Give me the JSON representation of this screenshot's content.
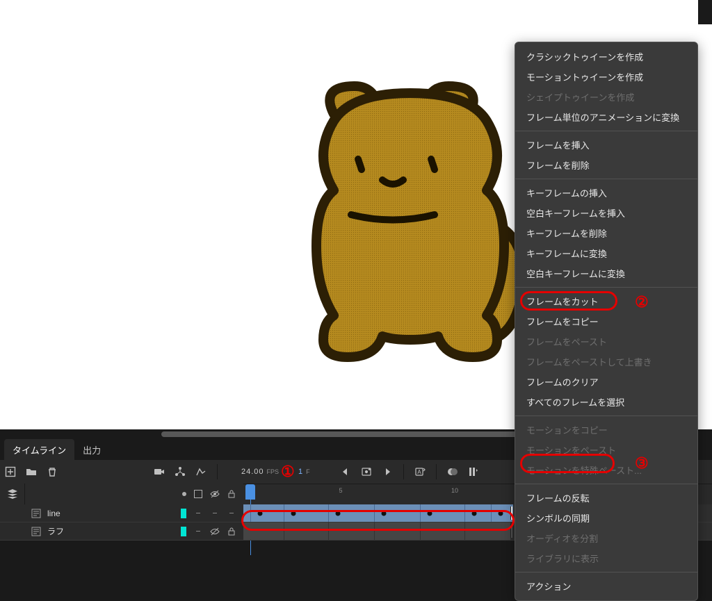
{
  "panel_tabs": {
    "timeline": "タイムライン",
    "output": "出力"
  },
  "timeline_top": {
    "fps_value": "24.00",
    "fps_label": "FPS",
    "frame_number": "1",
    "frame_label": "F"
  },
  "ruler": {
    "marks": [
      5,
      10
    ]
  },
  "layers": {
    "row1": {
      "name": "line"
    },
    "row2": {
      "name": "ラフ"
    }
  },
  "context_menu": {
    "groups": [
      [
        {
          "label": "クラシックトゥイーンを作成",
          "disabled": false
        },
        {
          "label": "モーショントゥイーンを作成",
          "disabled": false
        },
        {
          "label": "シェイプトゥイーンを作成",
          "disabled": true
        },
        {
          "label": "フレーム単位のアニメーションに変換",
          "disabled": false
        }
      ],
      [
        {
          "label": "フレームを挿入",
          "disabled": false
        },
        {
          "label": "フレームを削除",
          "disabled": false
        }
      ],
      [
        {
          "label": "キーフレームの挿入",
          "disabled": false
        },
        {
          "label": "空白キーフレームを挿入",
          "disabled": false
        },
        {
          "label": "キーフレームを削除",
          "disabled": false
        },
        {
          "label": "キーフレームに変換",
          "disabled": false
        },
        {
          "label": "空白キーフレームに変換",
          "disabled": false
        }
      ],
      [
        {
          "label": "フレームをカット",
          "disabled": false
        },
        {
          "label": "フレームをコピー",
          "disabled": false
        },
        {
          "label": "フレームをペースト",
          "disabled": true
        },
        {
          "label": "フレームをペーストして上書き",
          "disabled": true
        },
        {
          "label": "フレームのクリア",
          "disabled": false
        },
        {
          "label": "すべてのフレームを選択",
          "disabled": false
        }
      ],
      [
        {
          "label": "モーションをコピー",
          "disabled": true
        },
        {
          "label": "モーションをペースト",
          "disabled": true
        },
        {
          "label": "モーションを特殊ペースト...",
          "disabled": true
        }
      ],
      [
        {
          "label": "フレームの反転",
          "disabled": false
        },
        {
          "label": "シンボルの同期",
          "disabled": false
        },
        {
          "label": "オーディオを分割",
          "disabled": true
        },
        {
          "label": "ライブラリに表示",
          "disabled": true
        }
      ],
      [
        {
          "label": "アクション",
          "disabled": false
        }
      ]
    ]
  },
  "annotations": {
    "a1": "①",
    "a2": "②",
    "a3": "③"
  }
}
